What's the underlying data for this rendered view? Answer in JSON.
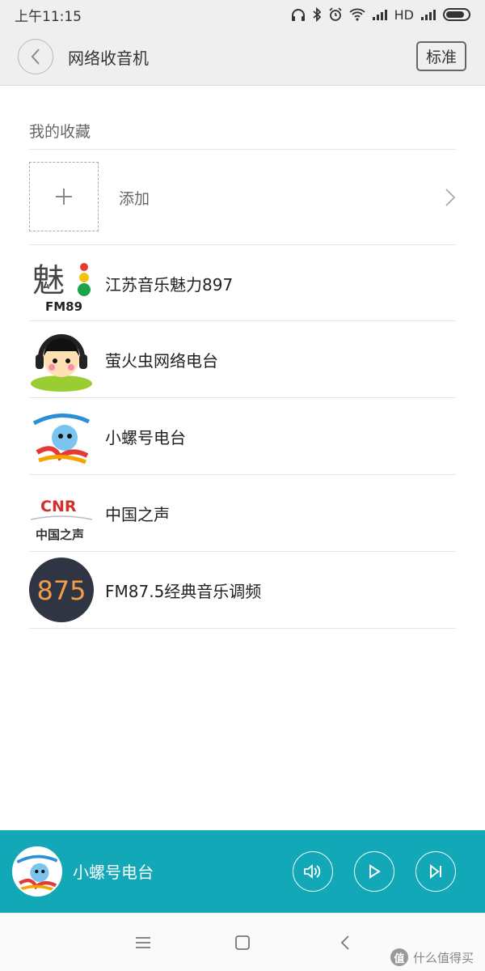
{
  "status_bar": {
    "time": "上午11:15",
    "network": "HD"
  },
  "header": {
    "title": "网络收音机",
    "mode_label": "标准"
  },
  "favorites": {
    "section_label": "我的收藏",
    "add_label": "添加",
    "stations": [
      {
        "name": "江苏音乐魅力897",
        "logo_text": "魅",
        "logo_sub": "FM89"
      },
      {
        "name": "萤火虫网络电台"
      },
      {
        "name": "小螺号电台"
      },
      {
        "name": "中国之声",
        "logo_text": "CNR",
        "logo_sub": "中国之声"
      },
      {
        "name": "FM87.5经典音乐调频",
        "logo_text": "875"
      }
    ]
  },
  "player": {
    "now_playing": "小螺号电台"
  },
  "watermark": {
    "text": "什么值得买",
    "badge": "值"
  },
  "colors": {
    "accent": "#12a8b8",
    "header_bg": "#efefef"
  },
  "icons": [
    "headphones-icon",
    "bluetooth-icon",
    "alarm-icon",
    "wifi-icon",
    "signal-icon",
    "battery-icon",
    "back-icon",
    "plus-icon",
    "chevron-right-icon",
    "volume-icon",
    "play-icon",
    "next-icon",
    "menu-icon",
    "home-icon",
    "nav-back-icon"
  ]
}
